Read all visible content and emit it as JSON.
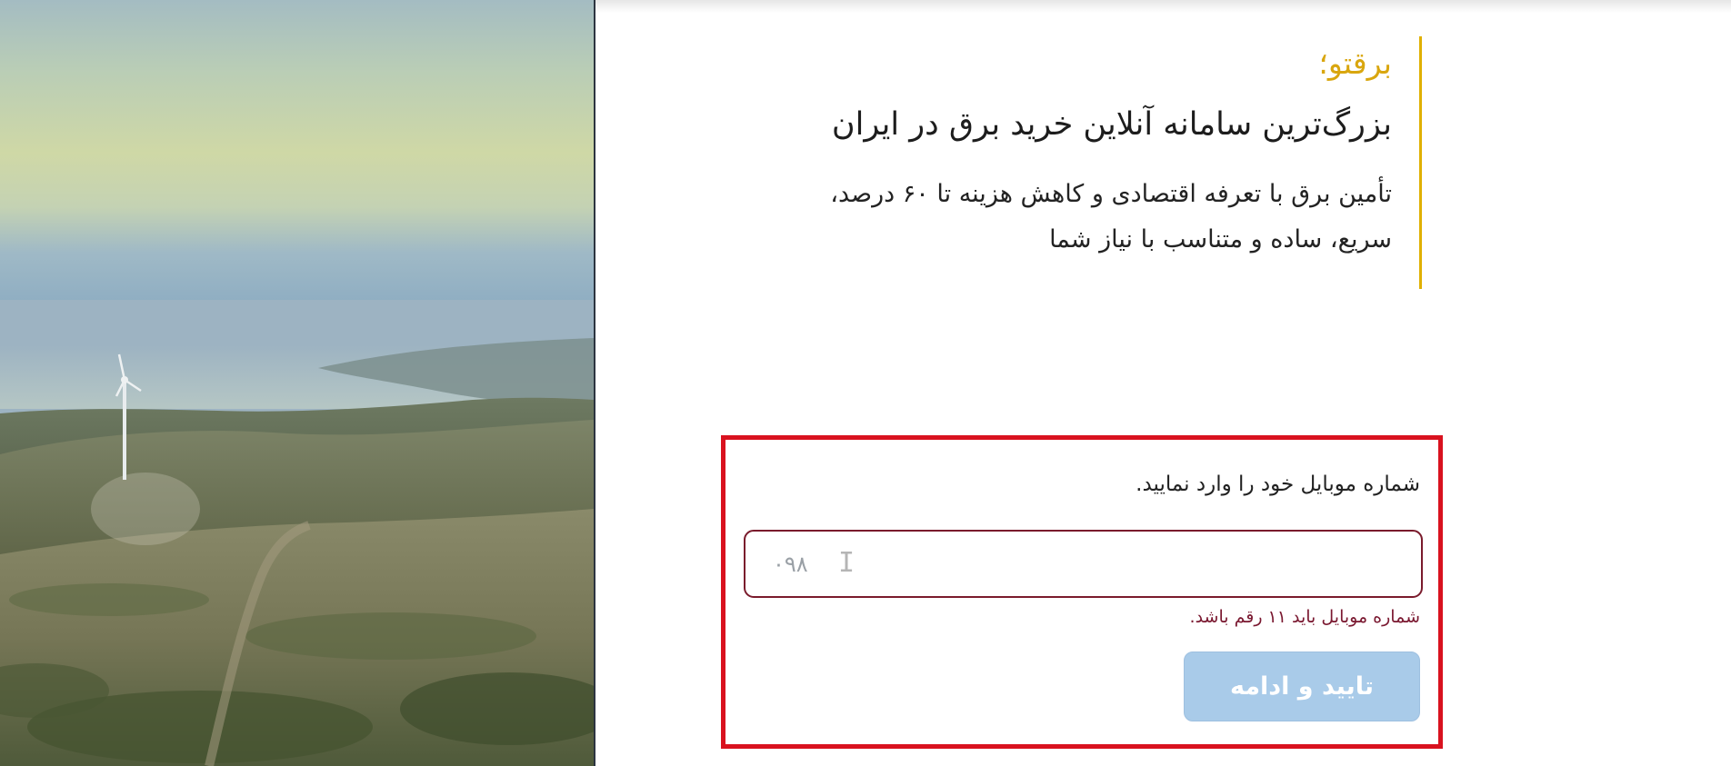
{
  "hero": {
    "image": "wind-turbine-landscape"
  },
  "intro": {
    "brand": "برقتو؛",
    "headline": "بزرگ‌ترین سامانه آنلاین خرید برق در ایران",
    "description_line1": "تأمین برق با تعرفه اقتصادی و کاهش هزینه تا ۶۰ درصد،",
    "description_line2": "سریع، ساده و متناسب با نیاز شما"
  },
  "form": {
    "label": "شماره موبایل خود را وارد نمایید.",
    "phone_value": "۰۹۸",
    "error": "شماره موبایل باید ۱۱ رقم باشد.",
    "submit_label": "تایید و ادامه"
  },
  "colors": {
    "brand_accent": "#d9a60e",
    "highlight_border": "#d9121f",
    "error_text": "#7a1830",
    "button_disabled": "#a9cbe9"
  }
}
